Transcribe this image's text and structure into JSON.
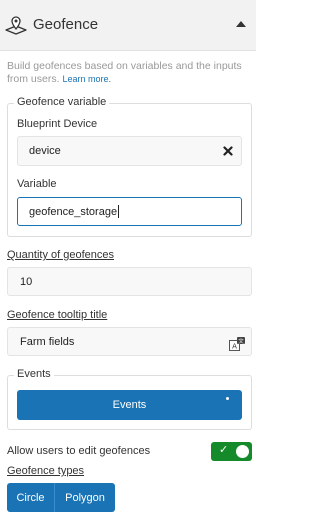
{
  "header": {
    "title": "Geofence",
    "icon": "geofence-icon",
    "collapse_icon": "caret-up-icon"
  },
  "description": {
    "text": "Build geofences based on variables and the inputs from users.",
    "link": "Learn more."
  },
  "geofence_variable": {
    "legend": "Geofence variable",
    "blueprint_label": "Blueprint Device",
    "blueprint_value": "device",
    "variable_label": "Variable",
    "variable_value": "geofence_storage"
  },
  "quantity": {
    "label": "Quantity of geofences",
    "value": "10"
  },
  "tooltip": {
    "label": "Geofence tooltip title",
    "value": "Farm fields"
  },
  "events": {
    "legend": "Events",
    "button_label": "Events"
  },
  "allow_edit": {
    "label": "Allow users to edit geofences",
    "enabled": true,
    "color": "#158a2a"
  },
  "types": {
    "label": "Geofence types",
    "options": [
      "Circle",
      "Polygon"
    ]
  },
  "colors": {
    "accent": "#1a73b5"
  }
}
